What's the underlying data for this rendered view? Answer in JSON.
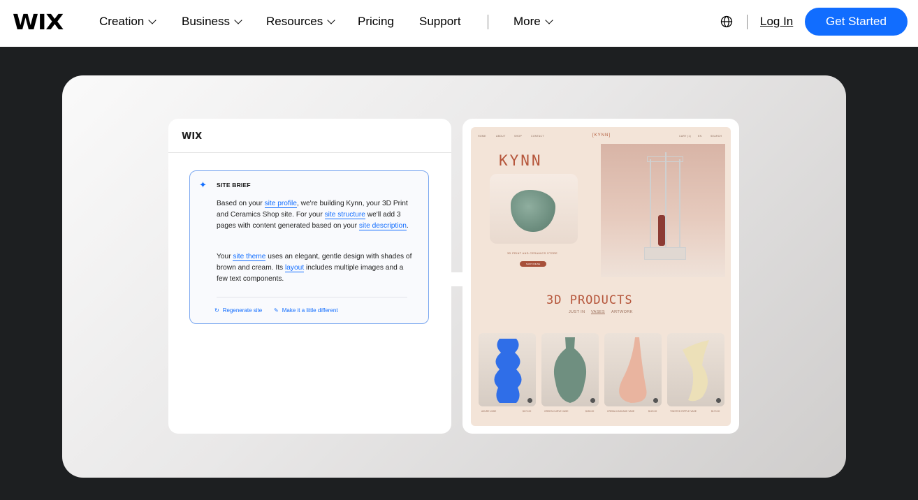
{
  "nav": {
    "logo": "WIX",
    "items": [
      {
        "label": "Creation",
        "dropdown": true
      },
      {
        "label": "Business",
        "dropdown": true
      },
      {
        "label": "Resources",
        "dropdown": true
      },
      {
        "label": "Pricing",
        "dropdown": false
      },
      {
        "label": "Support",
        "dropdown": false
      },
      {
        "label": "More",
        "dropdown": true
      }
    ],
    "login_label": "Log In",
    "cta_label": "Get Started",
    "icons": {
      "language": "globe-icon"
    },
    "colors": {
      "cta": "#116dff",
      "background": "#1d1f21"
    }
  },
  "editor_panel": {
    "logo": "WIX",
    "brief_title": "SITE BRIEF",
    "para1": {
      "t1": "Based on your ",
      "link1": "site profile",
      "t2": ", we're building Kynn, your 3D Print and Ceramics Shop site. For your ",
      "link2": "site structure",
      "t3": " we'll add 3 pages with content generated based on your ",
      "link3": "site description",
      "t4": "."
    },
    "para2": {
      "t1": "Your ",
      "link1": "site theme",
      "t2": " uses an elegant, gentle design with shades of brown and cream. Its ",
      "link2": "layout",
      "t3": " includes multiple images and a few text components."
    },
    "actions": {
      "regenerate": "Regenerate site",
      "different": "Make it a little different"
    }
  },
  "preview": {
    "nav_left": [
      "HOME",
      "ABOUT",
      "SHOP",
      "CONTACT"
    ],
    "nav_logo": "[KYNN]",
    "nav_right": [
      "CART (1)",
      "EN",
      "SEARCH"
    ],
    "brand": "KYNN",
    "store_label": "3D PRINT AND CERAMICS STORE",
    "shop_button": "SHOP ONLINE",
    "products_title": "3D PRODUCTS",
    "tabs": [
      "JUST IN",
      "VASES",
      "ARTWORK"
    ],
    "products": [
      {
        "name": "AZURE VASE",
        "price": "$170.00",
        "color": "#2f6ee8"
      },
      {
        "name": "GREEN CURVE VASE",
        "price": "$150.00",
        "color": "#6f8f80"
      },
      {
        "name": "CREMA CASCADE VASE",
        "price": "$120.00",
        "color": "#e9b49f"
      },
      {
        "name": "TWISTED RIPPLE VASE",
        "price": "$170.00",
        "color": "#ece0b8"
      }
    ]
  }
}
